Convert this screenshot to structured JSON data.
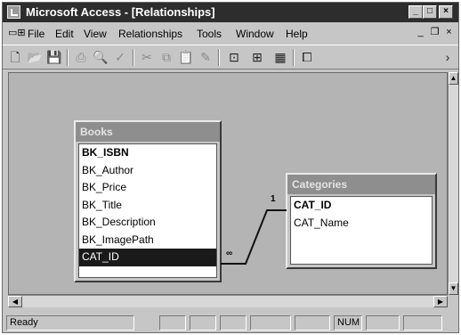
{
  "window": {
    "title": "Microsoft Access - [Relationships]",
    "controls": {
      "minimize": "_",
      "maximize": "□",
      "close": "×"
    }
  },
  "menubar": {
    "doc_icon": "▭⊞",
    "items": [
      "File",
      "Edit",
      "View",
      "Relationships",
      "Tools",
      "Window",
      "Help"
    ],
    "mdi_controls": {
      "minimize": "_",
      "restore": "❐",
      "close": "×"
    }
  },
  "toolbar": {
    "buttons": [
      {
        "name": "new-icon",
        "glyph": "🗋"
      },
      {
        "name": "open-icon",
        "glyph": "📂"
      },
      {
        "name": "save-icon",
        "glyph": "💾"
      },
      {
        "name": "print-icon",
        "glyph": "⎙"
      },
      {
        "name": "print-preview-icon",
        "glyph": "🔍"
      },
      {
        "name": "spelling-icon",
        "glyph": "✓"
      },
      {
        "name": "cut-icon",
        "glyph": "✂"
      },
      {
        "name": "copy-icon",
        "glyph": "⧉"
      },
      {
        "name": "paste-icon",
        "glyph": "📋"
      },
      {
        "name": "format-painter-icon",
        "glyph": "✎"
      },
      {
        "name": "show-table-icon",
        "glyph": "⊡"
      },
      {
        "name": "show-direct-icon",
        "glyph": "⊞"
      },
      {
        "name": "show-all-icon",
        "glyph": "▦"
      },
      {
        "name": "database-window-icon",
        "glyph": "⧠"
      },
      {
        "name": "new-object-icon",
        "glyph": "›"
      }
    ]
  },
  "tables": {
    "books": {
      "title": "Books",
      "fields": [
        "BK_ISBN",
        "BK_Author",
        "BK_Price",
        "BK_Title",
        "BK_Description",
        "BK_ImagePath",
        "CAT_ID"
      ],
      "key_field": "BK_ISBN",
      "selected_field": "CAT_ID"
    },
    "categories": {
      "title": "Categories",
      "fields": [
        "CAT_ID",
        "CAT_Name"
      ],
      "key_field": "CAT_ID"
    }
  },
  "relationship": {
    "one_label": "1",
    "many_label": "∞"
  },
  "statusbar": {
    "status": "Ready",
    "num_indicator": "NUM"
  },
  "colors": {
    "title_bar": "#2d2d2d",
    "canvas": "#b4b4b4",
    "table_title": "#8e8e8e",
    "selection": "#1a1a1a"
  }
}
